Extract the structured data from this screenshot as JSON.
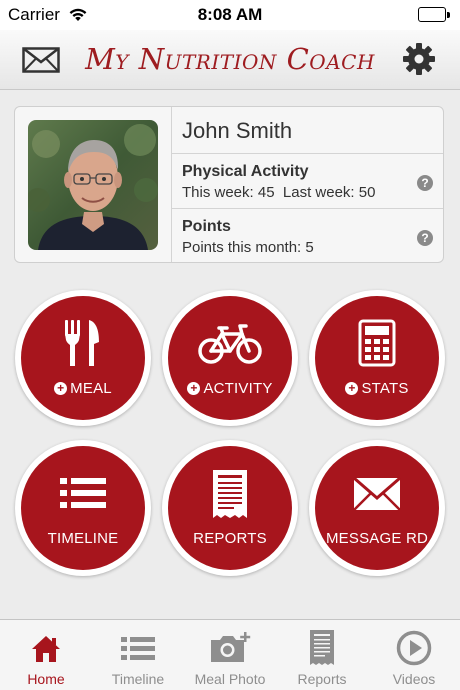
{
  "status_bar": {
    "carrier": "Carrier",
    "time": "8:08 AM"
  },
  "header": {
    "title": "My Nutrition Coach"
  },
  "profile": {
    "name": "John Smith",
    "physical_activity": {
      "title": "Physical Activity",
      "this_week": "This week: 45",
      "last_week": "Last week: 50"
    },
    "points": {
      "title": "Points",
      "value": "Points this month: 5"
    },
    "help_glyph": "?"
  },
  "actions": [
    {
      "label": "MEAL",
      "icon": "fork-knife-icon",
      "has_plus": true
    },
    {
      "label": "ACTIVITY",
      "icon": "bicycle-icon",
      "has_plus": true
    },
    {
      "label": "STATS",
      "icon": "calculator-icon",
      "has_plus": true
    },
    {
      "label": "TIMELINE",
      "icon": "list-icon",
      "has_plus": false
    },
    {
      "label": "REPORTS",
      "icon": "report-icon",
      "has_plus": false
    },
    {
      "label": "MESSAGE RD",
      "icon": "envelope-icon",
      "has_plus": false
    }
  ],
  "tabs": [
    {
      "label": "Home",
      "icon": "home-icon",
      "active": true
    },
    {
      "label": "Timeline",
      "icon": "list-icon",
      "active": false
    },
    {
      "label": "Meal Photo",
      "icon": "camera-icon",
      "active": false
    },
    {
      "label": "Reports",
      "icon": "report-icon",
      "active": false
    },
    {
      "label": "Videos",
      "icon": "play-icon",
      "active": false
    }
  ],
  "colors": {
    "accent": "#a7151d",
    "title": "#9e1c20",
    "tab_inactive": "#8e8e8e"
  }
}
